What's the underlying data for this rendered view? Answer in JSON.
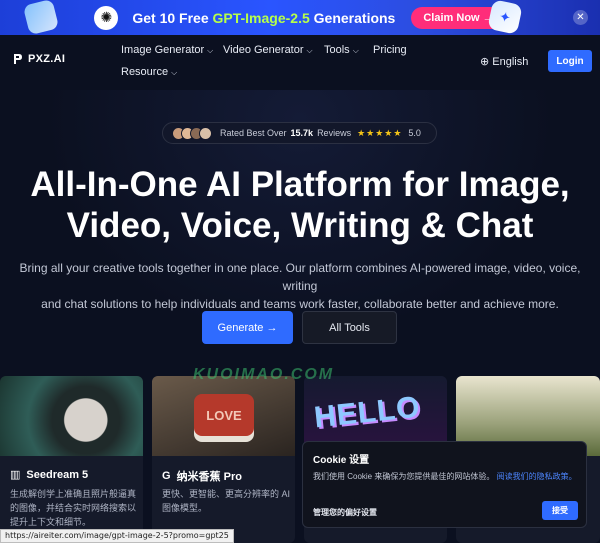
{
  "promo": {
    "text_prefix": "Get 10 Free ",
    "text_highlight": "GPT-Image-2.5",
    "text_suffix": " Generations",
    "claim_label": "Claim Now →",
    "close_label": "✕"
  },
  "header": {
    "logo_text": "PXZ.AI",
    "nav": [
      {
        "label": "Image Generator",
        "has_dropdown": true
      },
      {
        "label": "Video Generator",
        "has_dropdown": true
      },
      {
        "label": "Tools",
        "has_dropdown": true
      },
      {
        "label": "Pricing",
        "has_dropdown": false
      },
      {
        "label": "Resource",
        "has_dropdown": true
      }
    ],
    "language": "English",
    "login_label": "Login"
  },
  "rating": {
    "prefix": "Rated Best Over",
    "count": "15.7k",
    "suffix": "Reviews",
    "stars": "★★★★★",
    "score": "5.0"
  },
  "hero": {
    "title_line1": "All-In-One AI Platform for Image,",
    "title_line2": "Video, Voice, Writing & Chat",
    "subtitle_line1": "Bring all your creative tools together in one place. Our platform combines AI-powered image, video, voice, writing",
    "subtitle_line2": "and chat solutions to help individuals and teams work faster, collaborate better and achieve more.",
    "generate_label": "Generate →",
    "all_tools_label": "All Tools"
  },
  "watermark": "KUOIMAO.COM",
  "cards": [
    {
      "icon": "▥",
      "title": "Seedream 5",
      "desc": "生成解创学上准确且照片般逼真的图像，并结合实时网络搜索以提升上下文和细节。"
    },
    {
      "icon": "G",
      "title": "纳米香蕉 Pro",
      "desc": "更快、更智能、更高分辨率的 AI 图像模型。",
      "image_text": "LOVE"
    },
    {
      "title": "",
      "desc": "",
      "image_text": "HELLO"
    },
    {
      "title": "",
      "desc": ""
    }
  ],
  "cookie": {
    "title": "Cookie 设置",
    "body": "我们使用 Cookie 来确保为您提供最佳的网站体验。",
    "link": "阅读我们的隐私政策。",
    "manage_label": "管理您的偏好设置",
    "accept_label": "接受"
  },
  "status_url": "https://aireiter.com/image/gpt-image-2-5?promo=gpt25",
  "colors": {
    "accent": "#2f6bff",
    "claim": "#ff2d7a",
    "promo_highlight": "#b6ff4a",
    "background": "#0b1020",
    "stars": "#f5c518"
  }
}
